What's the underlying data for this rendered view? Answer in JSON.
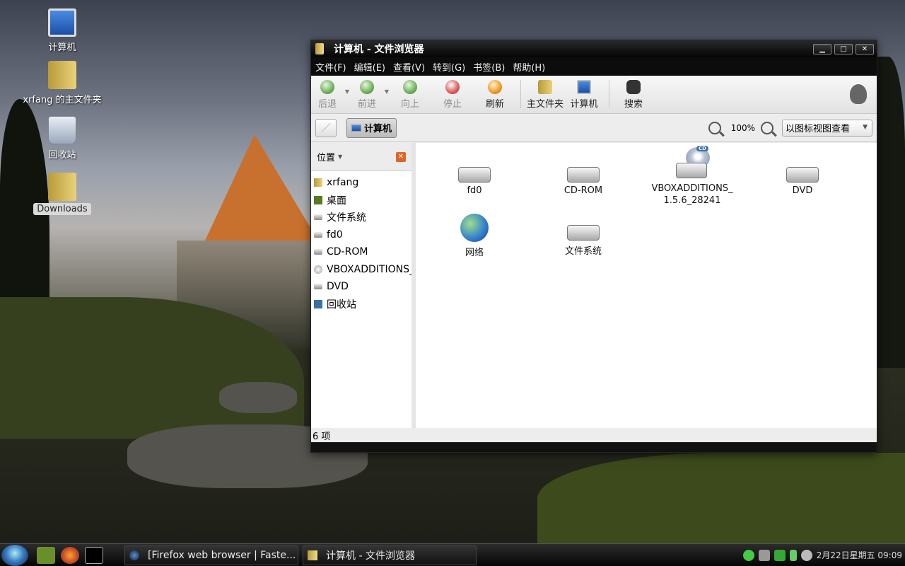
{
  "desktop": {
    "icons": [
      {
        "label": "计算机"
      },
      {
        "label": "xrfang 的主文件夹"
      },
      {
        "label": "回收站"
      },
      {
        "label": "Downloads"
      }
    ]
  },
  "window": {
    "title": "计算机 - 文件浏览器",
    "controls": {
      "minimize": "▁",
      "maximize": "□",
      "close": "✕"
    },
    "menu": [
      "文件(F)",
      "编辑(E)",
      "查看(V)",
      "转到(G)",
      "书签(B)",
      "帮助(H)"
    ],
    "toolbar": {
      "back": "后退",
      "forward": "前进",
      "up": "向上",
      "stop": "停止",
      "reload": "刷新",
      "home": "主文件夹",
      "computer": "计算机",
      "search": "搜索"
    },
    "location": {
      "path_button": "计算机",
      "zoom": "100%",
      "view_mode": "以图标视图查看"
    },
    "sidepane": {
      "title": "位置",
      "items": [
        "xrfang",
        "桌面",
        "文件系统",
        "fd0",
        "CD-ROM",
        "VBOXADDITIONS_",
        "DVD",
        "回收站"
      ]
    },
    "items": [
      {
        "label": "fd0"
      },
      {
        "label": "CD-ROM"
      },
      {
        "label": "VBOXADDITIONS_\n1.5.6_28241",
        "badge": "CD"
      },
      {
        "label": "DVD"
      },
      {
        "label": "网络"
      },
      {
        "label": "文件系统"
      }
    ],
    "status": "6 项"
  },
  "taskbar": {
    "tasks": [
      "[Firefox web browser | Faste...",
      "计算机 - 文件浏览器"
    ],
    "clock": "2月22日星期五 09:09"
  }
}
